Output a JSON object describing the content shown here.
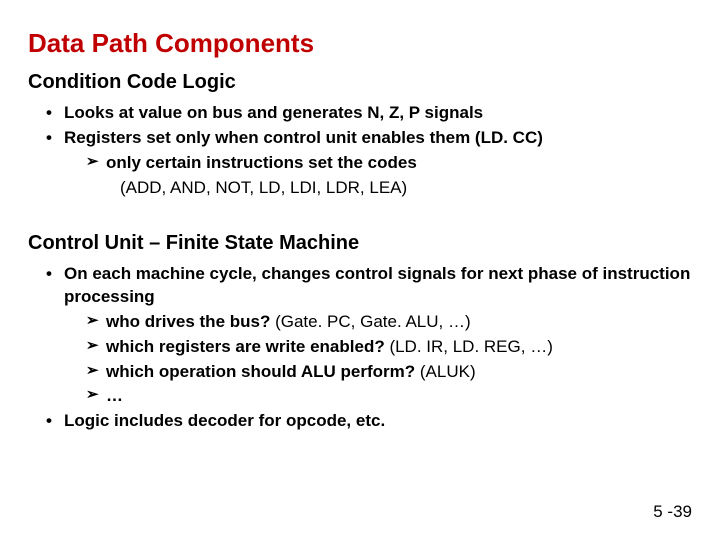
{
  "title": "Data Path Components",
  "section1": {
    "heading": "Condition Code Logic",
    "b1": "Looks at value on bus and generates N, Z, P signals",
    "b2": "Registers set only when control unit enables them (LD. CC)",
    "b2a": "only certain instructions set the codes",
    "b2a_sub": "(ADD, AND, NOT, LD, LDI, LDR, LEA)"
  },
  "section2": {
    "heading": "Control Unit – Finite State Machine",
    "b1": "On each machine cycle, changes control signals for next phase of instruction processing",
    "b1a_bold": "who drives the bus?",
    "b1a_rest": " (Gate. PC, Gate. ALU, …)",
    "b1b_bold": "which registers are write enabled?",
    "b1b_rest": " (LD. IR, LD. REG, …)",
    "b1c_bold": "which operation should ALU perform?",
    "b1c_rest": " (ALUK)",
    "b1d": "…",
    "b2": "Logic includes decoder for opcode, etc."
  },
  "pagenum": "5 -39"
}
